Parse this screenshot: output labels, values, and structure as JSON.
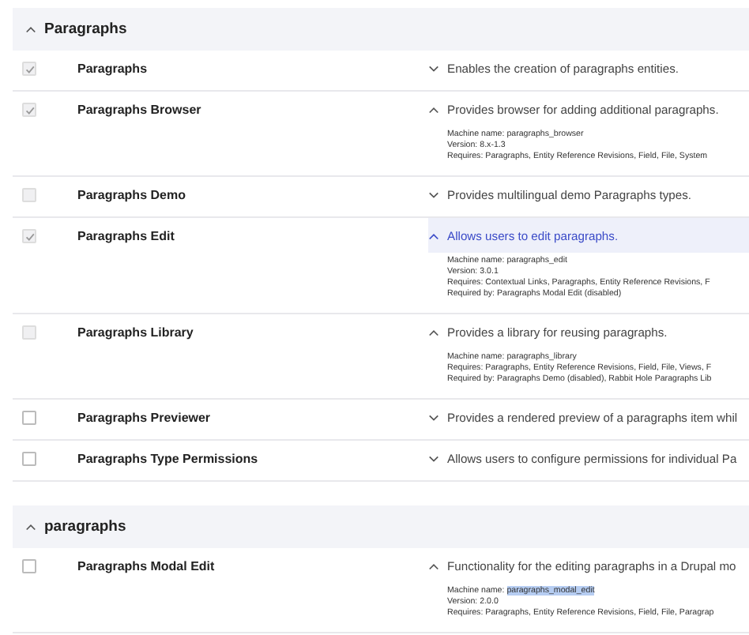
{
  "sections": [
    {
      "title": "Paragraphs",
      "expanded": true,
      "modules": [
        {
          "name": "Paragraphs",
          "checked": true,
          "disabled": true,
          "expanded": false,
          "highlighted": false,
          "description": "Enables the creation of paragraphs entities."
        },
        {
          "name": "Paragraphs Browser",
          "checked": true,
          "disabled": true,
          "expanded": true,
          "highlighted": false,
          "description": "Provides browser for adding additional paragraphs.",
          "details": [
            {
              "label": "Machine name:",
              "value": "paragraphs_browser",
              "selected": false
            },
            {
              "label": "Version:",
              "value": "8.x-1.3",
              "selected": false
            },
            {
              "label": "Requires:",
              "value": "Paragraphs, Entity Reference Revisions, Field, File, System",
              "selected": false
            }
          ]
        },
        {
          "name": "Paragraphs Demo",
          "checked": false,
          "disabled": true,
          "expanded": false,
          "highlighted": false,
          "description": "Provides multilingual demo Paragraphs types."
        },
        {
          "name": "Paragraphs Edit",
          "checked": true,
          "disabled": true,
          "expanded": true,
          "highlighted": true,
          "description": "Allows users to edit paragraphs.",
          "details": [
            {
              "label": "Machine name:",
              "value": "paragraphs_edit",
              "selected": false
            },
            {
              "label": "Version:",
              "value": "3.0.1",
              "selected": false
            },
            {
              "label": "Requires:",
              "value": "Contextual Links, Paragraphs, Entity Reference Revisions, F",
              "selected": false
            },
            {
              "label": "Required by:",
              "value": "Paragraphs Modal Edit (disabled)",
              "selected": false
            }
          ]
        },
        {
          "name": "Paragraphs Library",
          "checked": false,
          "disabled": true,
          "expanded": true,
          "highlighted": false,
          "description": "Provides a library for reusing paragraphs.",
          "details": [
            {
              "label": "Machine name:",
              "value": "paragraphs_library",
              "selected": false
            },
            {
              "label": "Requires:",
              "value": "Paragraphs, Entity Reference Revisions, Field, File, Views, F",
              "selected": false
            },
            {
              "label": "Required by:",
              "value": "Paragraphs Demo (disabled), Rabbit Hole Paragraphs Lib",
              "selected": false
            }
          ]
        },
        {
          "name": "Paragraphs Previewer",
          "checked": false,
          "disabled": false,
          "expanded": false,
          "highlighted": false,
          "description": "Provides a rendered preview of a paragraphs item whil"
        },
        {
          "name": "Paragraphs Type Permissions",
          "checked": false,
          "disabled": false,
          "expanded": false,
          "highlighted": false,
          "description": "Allows users to configure permissions for individual Pa"
        }
      ]
    },
    {
      "title": "paragraphs",
      "expanded": true,
      "modules": [
        {
          "name": "Paragraphs Modal Edit",
          "checked": false,
          "disabled": false,
          "expanded": true,
          "highlighted": false,
          "description": "Functionality for the editing paragraphs in a Drupal mo",
          "details": [
            {
              "label": "Machine name:",
              "value": "paragraphs_modal_edit",
              "selected": true
            },
            {
              "label": "Version:",
              "value": "2.0.0",
              "selected": false
            },
            {
              "label": "Requires:",
              "value": "Paragraphs, Entity Reference Revisions, Field, File, Paragrap",
              "selected": false
            }
          ]
        }
      ]
    }
  ]
}
